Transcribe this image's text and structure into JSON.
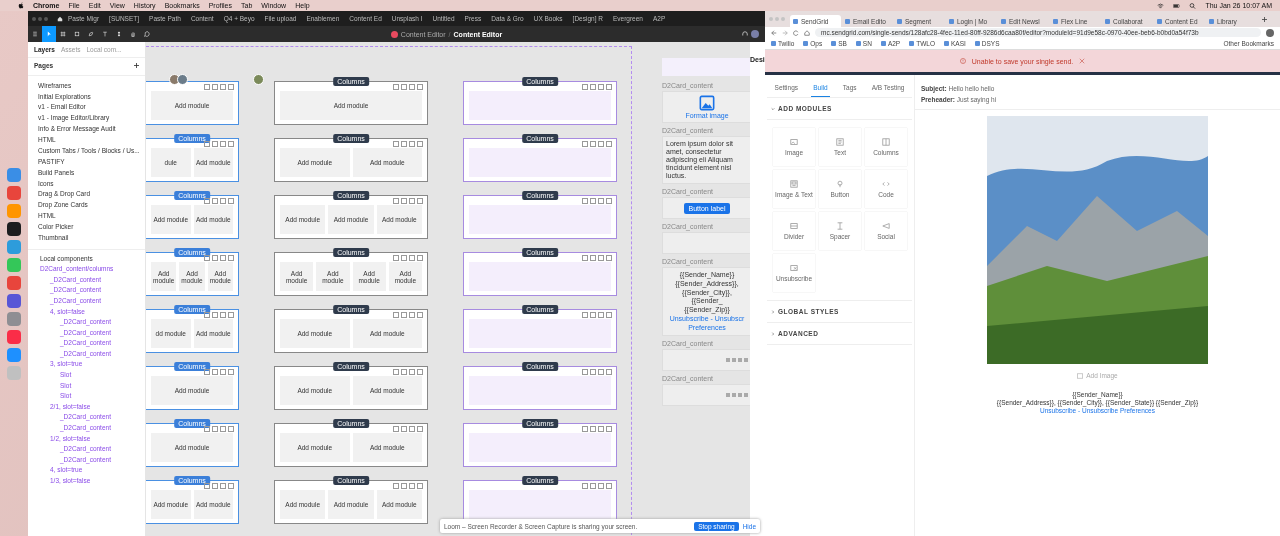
{
  "menu_bar": {
    "app": "Chrome",
    "items": [
      "File",
      "Edit",
      "View",
      "History",
      "Bookmarks",
      "Profiles",
      "Tab",
      "Window",
      "Help"
    ],
    "clock": "Thu Jan 26  10:07 AM"
  },
  "figma": {
    "tabs": [
      "Paste Migr",
      "[SUNSET] ",
      "Paste Path",
      "Content",
      "Q4 + Beyo",
      "File upload",
      "Enablemen",
      "Content Ed",
      "Unsplash I",
      "Untitled",
      "Press",
      "Data & Gro",
      "UX Books",
      "[Design] R",
      "Evergreen",
      "A2P"
    ],
    "tools": [
      {
        "kind": "menu",
        "selected": false
      },
      {
        "kind": "move",
        "selected": true
      },
      {
        "kind": "frame",
        "selected": false
      },
      {
        "kind": "shape",
        "selected": false
      },
      {
        "kind": "pen",
        "selected": false
      },
      {
        "kind": "text",
        "selected": false
      },
      {
        "kind": "components",
        "selected": false
      },
      {
        "kind": "hand",
        "selected": false
      },
      {
        "kind": "comment",
        "selected": false
      }
    ],
    "breadcrumb": {
      "project": "Content Editor",
      "separator": "/",
      "file": "Content Editor"
    },
    "panel_tabs": [
      {
        "label": "Layers",
        "selected": true
      },
      {
        "label": "Assets",
        "selected": false
      },
      {
        "label": "Local com...",
        "selected": false
      }
    ],
    "pages_title": "Pages",
    "pages": [
      "Wireframes",
      "Initial Explorations",
      "v1 - Email Editor",
      "v1 - Image Editor/Library",
      "Info & Error Message Audit",
      "HTML",
      "Custom Tabs / Tools / Blocks / Us...",
      "PASTIFY",
      "Build Panels",
      "Icons",
      "Drag & Drop Card",
      "Drop Zone Cards",
      "HTML",
      "Color Picker",
      "Thumbnail"
    ],
    "local_components": "Local components",
    "layers": [
      {
        "name": "D2Card_content/columns",
        "children": [
          {
            "name": "_D2Card_content"
          },
          {
            "name": "_D2Card_content"
          },
          {
            "name": "_D2Card_content"
          },
          {
            "name": "4, slot=false",
            "children": [
              {
                "name": "_D2Card_content"
              },
              {
                "name": "_D2Card_content"
              },
              {
                "name": "_D2Card_content"
              },
              {
                "name": "_D2Card_content"
              }
            ]
          },
          {
            "name": "3, slot=true",
            "children": [
              {
                "name": "Slot"
              },
              {
                "name": "Slot"
              },
              {
                "name": "Slot"
              }
            ]
          },
          {
            "name": "2/1, slot=false",
            "children": [
              {
                "name": "_D2Card_content"
              },
              {
                "name": "_D2Card_content"
              }
            ]
          },
          {
            "name": "1/2, slot=false",
            "children": [
              {
                "name": "_D2Card_content"
              },
              {
                "name": "_D2Card_content"
              }
            ]
          },
          {
            "name": "4, slot=true"
          },
          {
            "name": "1/3, slot=false"
          }
        ]
      }
    ],
    "canvas_columns": [
      {
        "kind": "filled",
        "cards": [
          {
            "modules": [
              "Add module"
            ]
          },
          {
            "badge": "Columns",
            "modules": [
              "dule",
              "Add module"
            ]
          },
          {
            "badge": "Columns",
            "modules": [
              "Add module",
              "Add module"
            ]
          },
          {
            "badge": "Columns",
            "modules": [
              "Add module",
              "Add module",
              "Add module"
            ]
          },
          {
            "badge": "Columns",
            "modules": [
              "dd module",
              "Add module"
            ]
          },
          {
            "badge": "Columns",
            "modules": [
              "Add module"
            ]
          },
          {
            "badge": "Columns",
            "modules": [
              "Add module"
            ]
          },
          {
            "badge": "Columns",
            "modules": [
              "Add module",
              "Add module"
            ]
          }
        ]
      },
      {
        "kind": "outlined",
        "cards": [
          {
            "badge": "Columns",
            "modules": [
              "Add module"
            ]
          },
          {
            "badge": "Columns",
            "modules": [
              "Add module",
              "Add module"
            ]
          },
          {
            "badge": "Columns",
            "modules": [
              "Add module",
              "Add module",
              "Add module"
            ]
          },
          {
            "badge": "Columns",
            "modules": [
              "Add module",
              "Add module",
              "Add module",
              "Add module"
            ]
          },
          {
            "badge": "Columns",
            "modules": [
              "Add module",
              "Add module"
            ]
          },
          {
            "badge": "Columns",
            "modules": [
              "Add module",
              "Add module"
            ]
          },
          {
            "badge": "Columns",
            "modules": [
              "Add module",
              "Add module"
            ]
          },
          {
            "badge": "Columns",
            "modules": [
              "Add module",
              "Add module",
              "Add module"
            ]
          }
        ]
      },
      {
        "kind": "slots",
        "cards": [
          {
            "badge": "Columns"
          },
          {
            "badge": "Columns"
          },
          {
            "badge": "Columns"
          },
          {
            "badge": "Columns"
          },
          {
            "badge": "Columns"
          },
          {
            "badge": "Columns"
          },
          {
            "badge": "Columns"
          },
          {
            "badge": "Columns"
          }
        ]
      }
    ],
    "previews": [
      {
        "kind": "image",
        "label": "D2Card_content",
        "text": "Format image"
      },
      {
        "kind": "text",
        "label": "D2Card_content",
        "text": "Lorem ipsum dolor sit amet, consectetur adipiscing eli Aliquam tincidunt element nisl luctus."
      },
      {
        "kind": "button",
        "label": "D2Card_content",
        "text": "Button label"
      },
      {
        "kind": "empty",
        "label": "D2Card_content"
      },
      {
        "kind": "footer",
        "label": "D2Card_content",
        "lines": [
          "{{Sender_Name}}",
          "{{Sender_Address}},",
          "{{Sender_City}}, {{Sender_",
          "{{Sender_Zip}}"
        ],
        "link": "Unsubscribe - Unsubscr",
        "link2": "Preferences"
      },
      {
        "kind": "social",
        "label": "D2Card_content"
      },
      {
        "kind": "social",
        "label": "D2Card_content"
      }
    ],
    "side_tab": "Desi"
  },
  "chrome": {
    "tabs": [
      {
        "label": "SendGrid",
        "selected": true
      },
      {
        "label": "Email Edito",
        "selected": false
      },
      {
        "label": "Segment",
        "selected": false
      },
      {
        "label": "Login | Mo",
        "selected": false
      },
      {
        "label": "Edit Newsl",
        "selected": false
      },
      {
        "label": "Flex Line",
        "selected": false
      },
      {
        "label": "Collaborat",
        "selected": false
      },
      {
        "label": "Content Ed",
        "selected": false
      },
      {
        "label": "Library",
        "selected": false
      }
    ],
    "url": "mc.sendgrid.com/single-sends/128afc28-4fec-11ed-80ff-9286d6caa80f/editor?moduleId=91d9e58c-0970-40ee-beb6-b0bd0a54f73b",
    "bookmarks": [
      "Twilio",
      "Ops",
      "SB",
      "SN",
      "A2P",
      "TWLO",
      "KASI",
      "DSYS"
    ],
    "other_bookmarks": "Other Bookmarks"
  },
  "sendgrid": {
    "error": "Unable to save your single send.",
    "tabs": [
      {
        "label": "Settings",
        "selected": false
      },
      {
        "label": "Build",
        "selected": true
      },
      {
        "label": "Tags",
        "selected": false
      },
      {
        "label": "A/B Testing",
        "selected": false
      }
    ],
    "sections": [
      {
        "title": "ADD MODULES",
        "expanded": true,
        "modules": [
          {
            "kind": "image",
            "label": "Image"
          },
          {
            "kind": "text",
            "label": "Text"
          },
          {
            "kind": "columns",
            "label": "Columns"
          },
          {
            "kind": "image-text",
            "label": "Image & Text"
          },
          {
            "kind": "button",
            "label": "Button"
          },
          {
            "kind": "code",
            "label": "Code"
          },
          {
            "kind": "divider",
            "label": "Divider"
          },
          {
            "kind": "spacer",
            "label": "Spacer"
          },
          {
            "kind": "social",
            "label": "Social"
          },
          {
            "kind": "unsubscribe",
            "label": "Unsubscribe"
          }
        ]
      },
      {
        "title": "GLOBAL STYLES",
        "expanded": false
      },
      {
        "title": "ADVANCED",
        "expanded": false
      }
    ],
    "subject_label": "Subject:",
    "subject": "Hello hello hello",
    "preheader_label": "Preheader:",
    "preheader": "Just saying hi",
    "add_image": "Add Image",
    "footer": [
      "{{Sender_Name}}",
      "{{Sender_Address}}, {{Sender_City}}, {{Sender_State}} {{Sender_Zip}}"
    ],
    "footer_link": "Unsubscribe - Unsubscribe Preferences"
  },
  "loom": {
    "message": "Loom – Screen Recorder & Screen Capture is sharing your screen.",
    "stop": "Stop sharing",
    "hide": "Hide"
  }
}
